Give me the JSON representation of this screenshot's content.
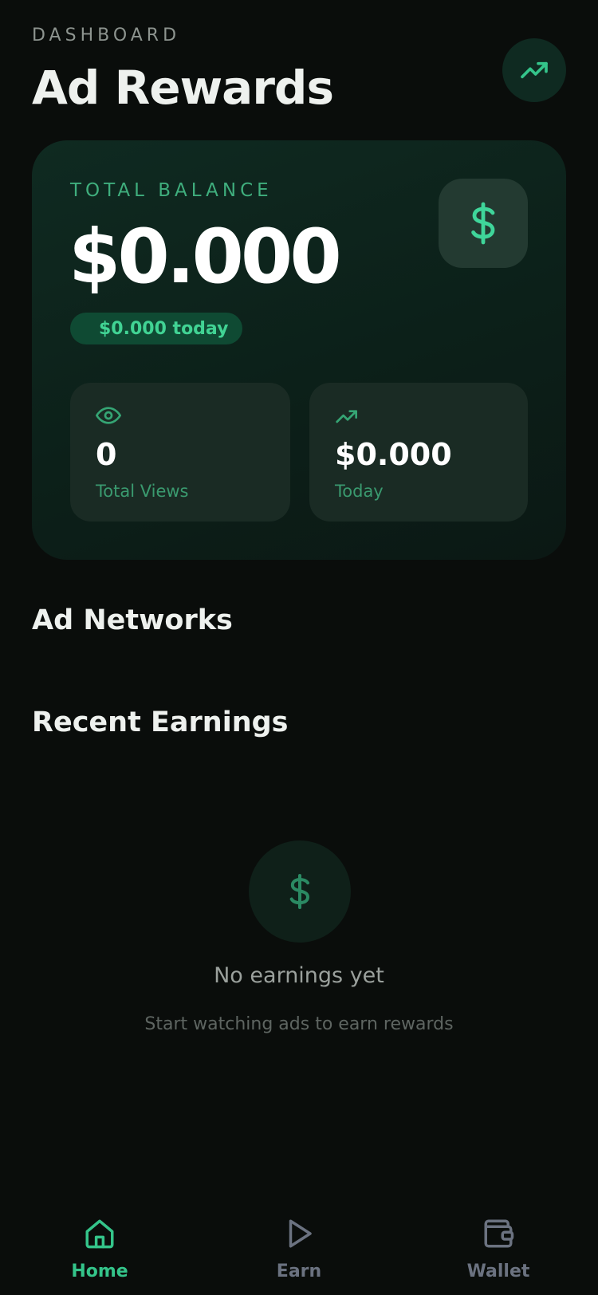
{
  "header": {
    "eyebrow": "DASHBOARD",
    "title": "Ad Rewards",
    "action_icon": "trending-up-icon"
  },
  "balance": {
    "label": "TOTAL BALANCE",
    "amount": "$0.000",
    "today_pill": "$0.000 today",
    "icon": "dollar-icon"
  },
  "stats": [
    {
      "icon": "eye-icon",
      "value": "0",
      "label": "Total Views"
    },
    {
      "icon": "trending-up-icon",
      "value": "$0.000",
      "label": "Today"
    }
  ],
  "sections": {
    "networks_title": "Ad Networks",
    "recent_title": "Recent Earnings"
  },
  "empty_state": {
    "icon": "dollar-icon",
    "title": "No earnings yet",
    "subtitle": "Start watching ads to earn rewards"
  },
  "nav": {
    "items": [
      {
        "label": "Home",
        "icon": "home-icon",
        "active": true
      },
      {
        "label": "Earn",
        "icon": "play-icon",
        "active": false
      },
      {
        "label": "Wallet",
        "icon": "wallet-icon",
        "active": false
      }
    ]
  },
  "colors": {
    "background": "#0a0d0b",
    "accent": "#34c48a",
    "card": "#0f2a21",
    "muted": "#6b7280"
  }
}
